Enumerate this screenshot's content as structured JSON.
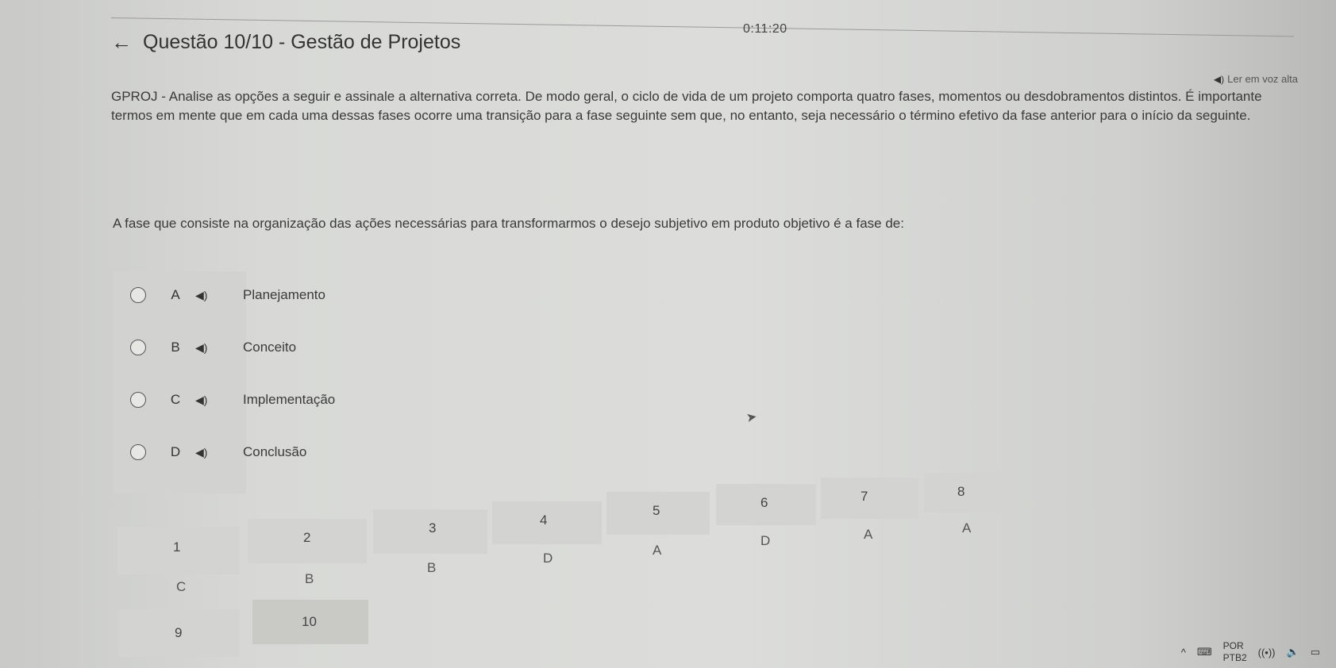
{
  "timer": "0:11:20",
  "header": {
    "back_icon": "←",
    "title": "Questão 10/10 - Gestão de Projetos"
  },
  "tts": {
    "icon": "◀)",
    "label": "Ler em voz alta"
  },
  "statement": "GPROJ - Analise as opções a seguir e assinale a alternativa correta. De modo geral, o ciclo de vida de um projeto comporta quatro fases, momentos ou desdobramentos distintos. É importante termos em mente que em cada uma dessas fases ocorre uma transição para a fase seguinte sem que, no entanto, seja necessário o término efetivo da fase anterior para o início da seguinte.",
  "question": "A fase que consiste na organização das ações necessárias para transformarmos o desejo subjetivo em produto objetivo é a fase de:",
  "options": [
    {
      "letter": "A",
      "speaker": "◀)",
      "text": "Planejamento"
    },
    {
      "letter": "B",
      "speaker": "◀)",
      "text": "Conceito"
    },
    {
      "letter": "C",
      "speaker": "◀)",
      "text": "Implementação"
    },
    {
      "letter": "D",
      "speaker": "◀)",
      "text": "Conclusão"
    }
  ],
  "navigator": [
    {
      "num": "1",
      "answer": "C"
    },
    {
      "num": "2",
      "answer": "B"
    },
    {
      "num": "3",
      "answer": "B"
    },
    {
      "num": "4",
      "answer": "D"
    },
    {
      "num": "5",
      "answer": "A"
    },
    {
      "num": "6",
      "answer": "D"
    },
    {
      "num": "7",
      "answer": "A"
    },
    {
      "num": "8",
      "answer": "A"
    },
    {
      "num": "9",
      "answer": ""
    },
    {
      "num": "10",
      "answer": ""
    }
  ],
  "taskbar": {
    "chevron": "^",
    "keyboard": "⌨",
    "lang1": "POR",
    "lang2": "PTB2",
    "wifi": "((•))",
    "volume": "🔈",
    "battery": "▭"
  }
}
